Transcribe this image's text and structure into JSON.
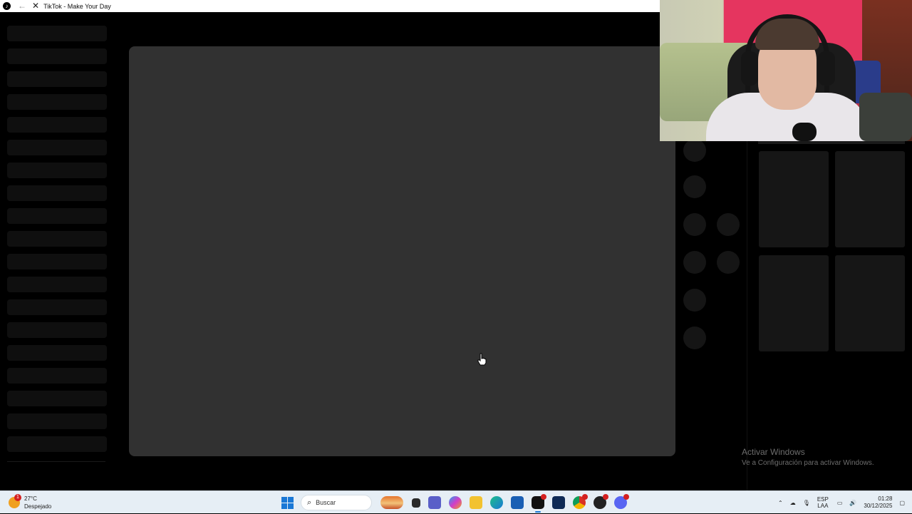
{
  "window": {
    "title": "TikTok - Make Your Day",
    "back_glyph": "←",
    "close_glyph": "✕"
  },
  "sidebar": {
    "skeleton_rows": 19
  },
  "watermark": {
    "line1": "Activar Windows",
    "line2": "Ve a Configuración para activar Windows."
  },
  "taskbar": {
    "weather": {
      "temp": "27°C",
      "condition": "Despejado",
      "badge": "1"
    },
    "search_placeholder": "Buscar",
    "apps": [
      "windows-start",
      "search",
      "news",
      "file-explorer",
      "teams",
      "copilot",
      "folder",
      "edge",
      "store",
      "tiktok",
      "photoshop",
      "chrome",
      "obs",
      "discord"
    ],
    "tray": {
      "lang_top": "ESP",
      "lang_bottom": "LAA",
      "time": "01:28",
      "date": "30/12/2025"
    }
  },
  "colors": {
    "video_placeholder": "#313131",
    "skeleton": "#0f0f0f",
    "accent": "#1a78d6"
  }
}
